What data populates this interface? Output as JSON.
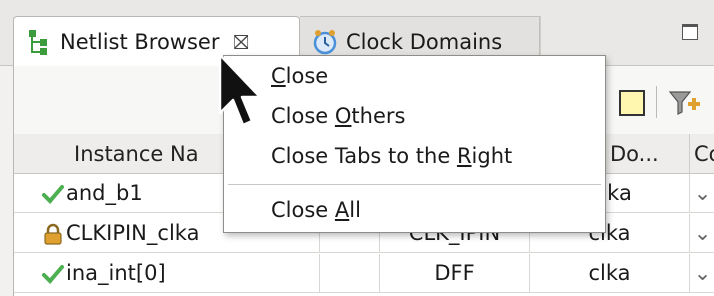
{
  "tabs": [
    {
      "label": "Netlist Browser",
      "active": true,
      "icon": "netlist-tree-icon",
      "close_glyph": "⛝"
    },
    {
      "label": "Clock Domains",
      "active": false,
      "icon": "clock-icon"
    }
  ],
  "toolbar": {
    "icons": [
      "yellow-square-icon",
      "filter-add-icon"
    ]
  },
  "table": {
    "columns": [
      "Instance Na",
      "",
      "",
      "Do...",
      "Co"
    ],
    "rows": [
      {
        "icon": "checkmark-icon",
        "name": "and_b1",
        "type": "",
        "domain": "...ka",
        "more": "⌄"
      },
      {
        "icon": "lock-icon",
        "name": "CLKIPIN_clka",
        "type": "CLK_IPIN",
        "domain": "clka",
        "more": "⌄"
      },
      {
        "icon": "checkmark-icon",
        "name": "ina_int[0]",
        "type": "DFF",
        "domain": "clka",
        "more": "⌄"
      }
    ]
  },
  "context_menu": {
    "items": [
      {
        "pre": "",
        "mnemonic": "C",
        "post": "lose"
      },
      {
        "pre": "Close ",
        "mnemonic": "O",
        "post": "thers"
      },
      {
        "pre": "Close Tabs to the ",
        "mnemonic": "R",
        "post": "ight"
      },
      {
        "pre": "Close ",
        "mnemonic": "A",
        "post": "ll"
      }
    ]
  },
  "colors": {
    "check": "#4caf50",
    "lock": "#e0a030",
    "clock": "#4a90d9"
  }
}
